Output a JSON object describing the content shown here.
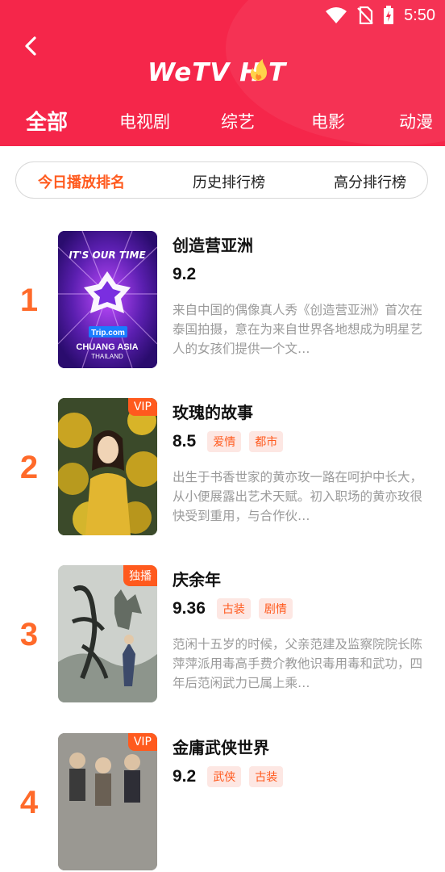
{
  "status_bar": {
    "time": "5:50"
  },
  "header": {
    "logo": "WeTV HOT",
    "tabs": [
      {
        "label": "全部",
        "active": true
      },
      {
        "label": "电视剧",
        "active": false
      },
      {
        "label": "综艺",
        "active": false
      },
      {
        "label": "电影",
        "active": false
      },
      {
        "label": "动漫",
        "active": false
      }
    ]
  },
  "subtabs": [
    {
      "label": "今日播放排名",
      "active": true
    },
    {
      "label": "历史排行榜",
      "active": false
    },
    {
      "label": "高分排行榜",
      "active": false
    }
  ],
  "items": [
    {
      "rank": "1",
      "title": "创造营亚洲",
      "score": "9.2",
      "tags": [],
      "badge": "",
      "poster_text": {
        "top": "IT'S OUR TIME",
        "brand": "Trip.com",
        "name": "CHUANG ASIA",
        "sub": "THAILAND"
      },
      "desc": "来自中国的偶像真人秀《创造营亚洲》首次在泰国拍摄，意在为来自世界各地想成为明星艺人的女孩们提供一个文…"
    },
    {
      "rank": "2",
      "title": "玫瑰的故事",
      "score": "8.5",
      "tags": [
        "爱情",
        "都市"
      ],
      "badge": "VIP",
      "desc": "出生于书香世家的黄亦玫一路在呵护中长大，从小便展露出艺术天赋。初入职场的黄亦玫很快受到重用，与合作伙…"
    },
    {
      "rank": "3",
      "title": "庆余年",
      "score": "9.36",
      "tags": [
        "古装",
        "剧情"
      ],
      "badge": "独播",
      "desc": "范闲十五岁的时候，父亲范建及监察院院长陈萍萍派用毒高手费介教他识毒用毒和武功，四年后范闲武力已属上乘…"
    },
    {
      "rank": "4",
      "title": "金庸武侠世界",
      "score": "9.2",
      "tags": [
        "武侠",
        "古装"
      ],
      "badge": "VIP",
      "desc": ""
    }
  ]
}
